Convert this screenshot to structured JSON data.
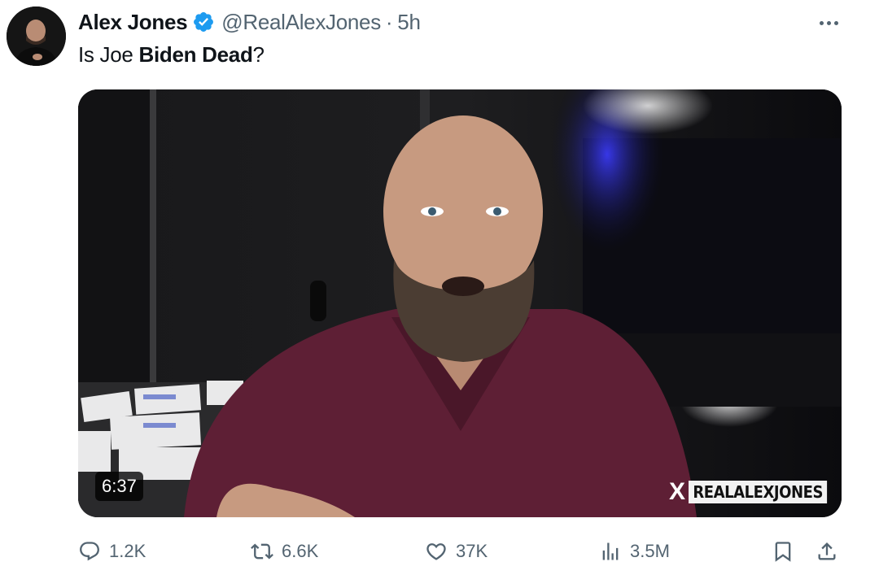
{
  "tweet": {
    "author": {
      "display_name": "Alex Jones",
      "handle": "@RealAlexJones",
      "separator": "·",
      "time": "5h",
      "verified": true,
      "verified_color": "#1d9bf0",
      "avatar_icon": "profile-photo"
    },
    "more_icon": "ellipsis-icon",
    "text": {
      "part1": "Is Joe ",
      "bold": "Biden Dead",
      "part2": "?"
    },
    "media": {
      "type": "video",
      "duration": "6:37",
      "watermark_mark": "X",
      "watermark_text": "REALALEXJONES"
    },
    "actions": {
      "replies": "1.2K",
      "reposts": "6.6K",
      "likes": "37K",
      "views": "3.5M",
      "icons": [
        "reply-icon",
        "repost-icon",
        "like-icon",
        "views-icon",
        "bookmark-icon",
        "share-icon"
      ]
    }
  },
  "colors": {
    "text_primary": "#0f1419",
    "text_secondary": "#536471",
    "shirt": "#5e1f35"
  }
}
